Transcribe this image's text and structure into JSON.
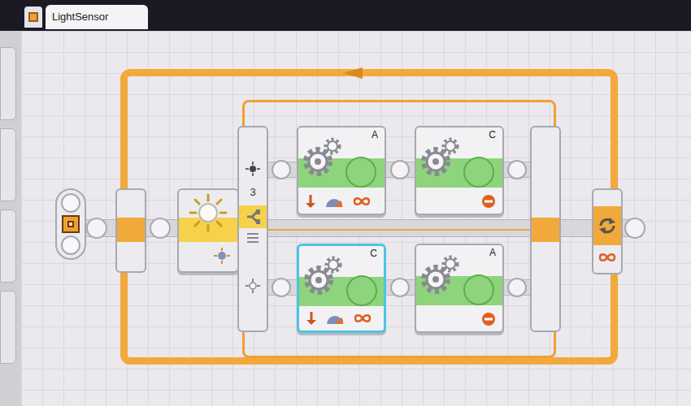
{
  "window": {
    "title": "LightSensor"
  },
  "switch": {
    "port": "3"
  },
  "motors": [
    {
      "port": "A",
      "kind": "run",
      "selected": false
    },
    {
      "port": "C",
      "kind": "stop",
      "selected": false
    },
    {
      "port": "C",
      "kind": "run",
      "selected": true
    },
    {
      "port": "A",
      "kind": "stop",
      "selected": false
    }
  ]
}
